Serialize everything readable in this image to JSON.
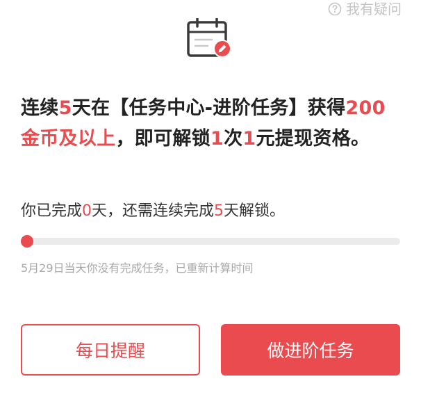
{
  "help": {
    "label": "我有疑问"
  },
  "headline": {
    "part1": "连续",
    "days": "5",
    "part2": "天在【任务中心-进阶任务】获得",
    "coins": "200金币及以上",
    "part3": "，即可解锁",
    "times": "1",
    "part4": "次",
    "amount": "1",
    "part5": "元提现资格。"
  },
  "status": {
    "prefix": "你已完成",
    "done_days": "0",
    "middle": "天，还需连续完成",
    "required_days": "5",
    "suffix": "天解锁。"
  },
  "progress": {
    "completed": 0,
    "required": 5
  },
  "note": "5月29日当天你没有完成任务，已重新计算时间",
  "buttons": {
    "reminder": "每日提醒",
    "advanced": "做进阶任务"
  },
  "colors": {
    "accent": "#e94b4f",
    "text": "#222222",
    "muted": "#a8a8a8",
    "track": "#ebebeb"
  },
  "icons": {
    "help": "question-circle-icon",
    "calendar": "calendar-edit-icon"
  }
}
